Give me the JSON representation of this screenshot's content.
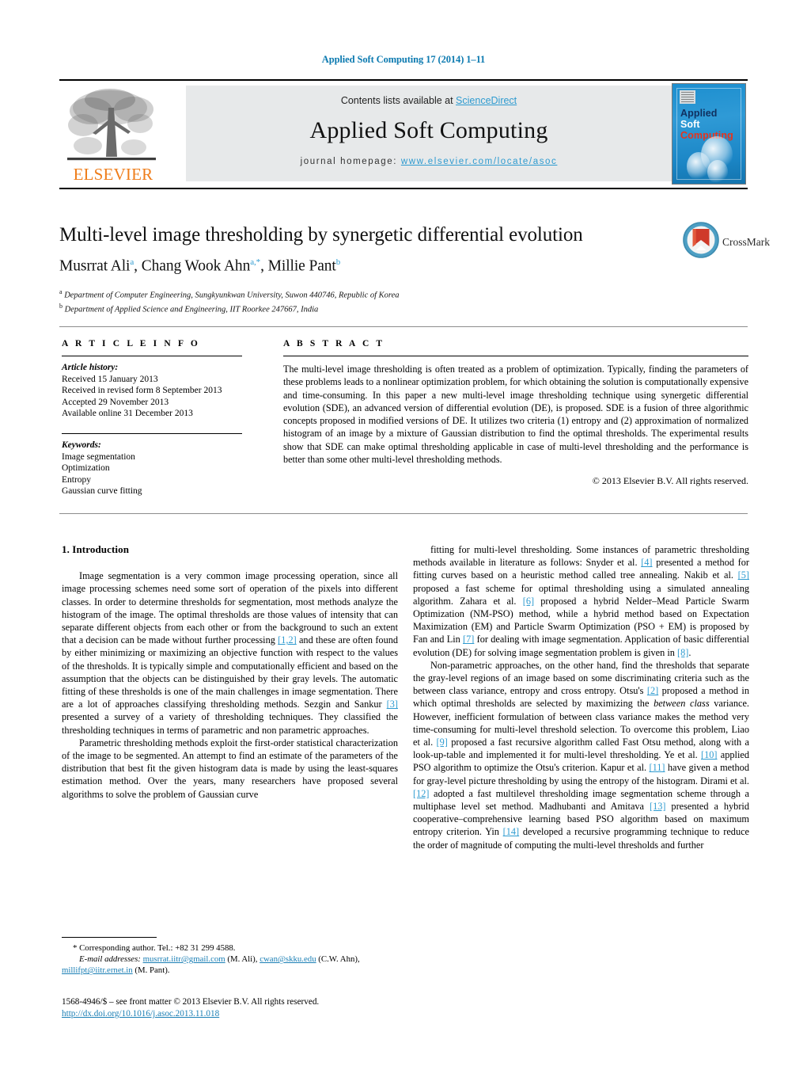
{
  "running_head": "Applied Soft Computing 17 (2014) 1–11",
  "masthead": {
    "elsevier_wordmark": "ELSEVIER",
    "contents_prefix": "Contents lists available at ",
    "sciencedirect": "ScienceDirect",
    "journal_title": "Applied Soft Computing",
    "homepage_label": "journal homepage: ",
    "homepage_url": "www.elsevier.com/locate/asoc",
    "cover": {
      "line1": "Applied",
      "line2": "Soft",
      "line3": "Computing"
    },
    "colors": {
      "link": "#2e9bd0",
      "elsevier_orange": "#ef7d1a",
      "cover_blue": "#1d8fcf",
      "cover_red": "#e8331c"
    }
  },
  "title_block": {
    "title": "Multi-level image thresholding by synergetic differential evolution",
    "authors": [
      {
        "name": "Musrrat Ali",
        "marks": "a"
      },
      {
        "name": "Chang Wook Ahn",
        "marks": "a,*"
      },
      {
        "name": "Millie Pant",
        "marks": "b"
      }
    ],
    "affiliations": [
      {
        "mark": "a",
        "text": "Department of Computer Engineering, Sungkyunkwan University, Suwon 440746, Republic of Korea"
      },
      {
        "mark": "b",
        "text": "Department of Applied Science and Engineering, IIT Roorkee 247667, India"
      }
    ],
    "crossmark_label": "CrossMark"
  },
  "article_info": {
    "heading": "A R T I C L E   I N F O",
    "history_heading": "Article history:",
    "history": [
      "Received 15 January 2013",
      "Received in revised form 8 September 2013",
      "Accepted 29 November 2013",
      "Available online 31 December 2013"
    ],
    "keywords_heading": "Keywords:",
    "keywords": [
      "Image segmentation",
      "Optimization",
      "Entropy",
      "Gaussian curve fitting"
    ]
  },
  "abstract": {
    "heading": "A B S T R A C T",
    "text": "The multi-level image thresholding is often treated as a problem of optimization. Typically, finding the parameters of these problems leads to a nonlinear optimization problem, for which obtaining the solution is computationally expensive and time-consuming. In this paper a new multi-level image thresholding technique using synergetic differential evolution (SDE), an advanced version of differential evolution (DE), is proposed. SDE is a fusion of three algorithmic concepts proposed in modified versions of DE. It utilizes two criteria (1) entropy and (2) approximation of normalized histogram of an image by a mixture of Gaussian distribution to find the optimal thresholds. The experimental results show that SDE can make optimal thresholding applicable in case of multi-level thresholding and the performance is better than some other multi-level thresholding methods.",
    "copyright": "© 2013 Elsevier B.V. All rights reserved."
  },
  "body": {
    "section_heading": "1.  Introduction",
    "left_paragraphs": [
      {
        "parts": [
          {
            "t": "Image segmentation is a very common image processing operation, since all image processing schemes need some sort of operation of the pixels into different classes. In order to determine thresholds for segmentation, most methods analyze the histogram of the image. The optimal thresholds are those values of intensity that can separate different objects from each other or from the background to such an extent that a decision can be made without further processing "
          },
          {
            "t": "[1,2]",
            "ref": true
          },
          {
            "t": " and these are often found by either minimizing or maximizing an objective function with respect to the values of the thresholds. It is typically simple and computationally efficient and based on the assumption that the objects can be distinguished by their gray levels. The automatic fitting of these thresholds is one of the main challenges in image segmentation. There are a lot of approaches classifying thresholding methods. Sezgin and Sankur "
          },
          {
            "t": "[3]",
            "ref": true
          },
          {
            "t": " presented a survey of a variety of thresholding techniques. They classified the thresholding techniques in terms of parametric and non parametric approaches."
          }
        ]
      },
      {
        "parts": [
          {
            "t": "Parametric thresholding methods exploit the first-order statistical characterization of the image to be segmented. An attempt to find an estimate of the parameters of the distribution that best fit the given histogram data is made by using the least-squares estimation method. Over the years, many researchers have proposed several algorithms to solve the problem of Gaussian curve"
          }
        ]
      }
    ],
    "right_paragraphs": [
      {
        "parts": [
          {
            "t": "fitting for multi-level thresholding. Some instances of parametric thresholding methods available in literature as follows: Snyder et al. "
          },
          {
            "t": "[4]",
            "ref": true
          },
          {
            "t": " presented a method for fitting curves based on a heuristic method called tree annealing. Nakib et al. "
          },
          {
            "t": "[5]",
            "ref": true
          },
          {
            "t": " proposed a fast scheme for optimal thresholding using a simulated annealing algorithm. Zahara et al. "
          },
          {
            "t": "[6]",
            "ref": true
          },
          {
            "t": " proposed a hybrid Nelder–Mead Particle Swarm Optimization (NM-PSO) method, while a hybrid method based on Expectation Maximization (EM) and Particle Swarm Optimization (PSO + EM) is proposed by Fan and Lin "
          },
          {
            "t": "[7]",
            "ref": true
          },
          {
            "t": " for dealing with image segmentation. Application of basic differential evolution (DE) for solving image segmentation problem is given in "
          },
          {
            "t": "[8]",
            "ref": true
          },
          {
            "t": "."
          }
        ]
      },
      {
        "parts": [
          {
            "t": "Non-parametric approaches, on the other hand, find the thresholds that separate the gray-level regions of an image based on some discriminating criteria such as the between class variance, entropy and cross entropy. Otsu's "
          },
          {
            "t": "[2]",
            "ref": true
          },
          {
            "t": " proposed a method in which optimal thresholds are selected by maximizing the "
          },
          {
            "t": "between class",
            "italic": true
          },
          {
            "t": " variance. However, inefficient formulation of between class variance makes the method very time-consuming for multi-level threshold selection. To overcome this problem, Liao et al. "
          },
          {
            "t": "[9]",
            "ref": true
          },
          {
            "t": " proposed a fast recursive algorithm called Fast Otsu method, along with a look-up-table and implemented it for multi-level thresholding. Ye et al. "
          },
          {
            "t": "[10]",
            "ref": true
          },
          {
            "t": " applied PSO algorithm to optimize the Otsu's criterion. Kapur et al. "
          },
          {
            "t": "[11]",
            "ref": true
          },
          {
            "t": " have given a method for gray-level picture thresholding by using the entropy of the histogram. Dirami et al. "
          },
          {
            "t": "[12]",
            "ref": true
          },
          {
            "t": " adopted a fast multilevel thresholding image segmentation scheme through a multiphase level set method. Madhubanti and Amitava "
          },
          {
            "t": "[13]",
            "ref": true
          },
          {
            "t": " presented a hybrid cooperative–comprehensive learning based PSO algorithm based on maximum entropy criterion. Yin "
          },
          {
            "t": "[14]",
            "ref": true
          },
          {
            "t": " developed a recursive programming technique to reduce the order of magnitude of computing the multi-level thresholds and further"
          }
        ]
      }
    ]
  },
  "footnote": {
    "corresponding": "*  Corresponding author. Tel.: +82 31 299 4588.",
    "email_label": "E-mail addresses:",
    "emails": [
      {
        "address": "musrrat.iitr@gmail.com",
        "owner": " (M. Ali),"
      },
      {
        "address": "cwan@skku.edu",
        "owner": " (C.W. Ahn),"
      },
      {
        "address": "millifpt@iitr.ernet.in",
        "owner": " (M. Pant)."
      }
    ]
  },
  "imprint": {
    "line": "1568-4946/$ – see front matter © 2013 Elsevier B.V. All rights reserved.",
    "doi": "http://dx.doi.org/10.1016/j.asoc.2013.11.018"
  }
}
